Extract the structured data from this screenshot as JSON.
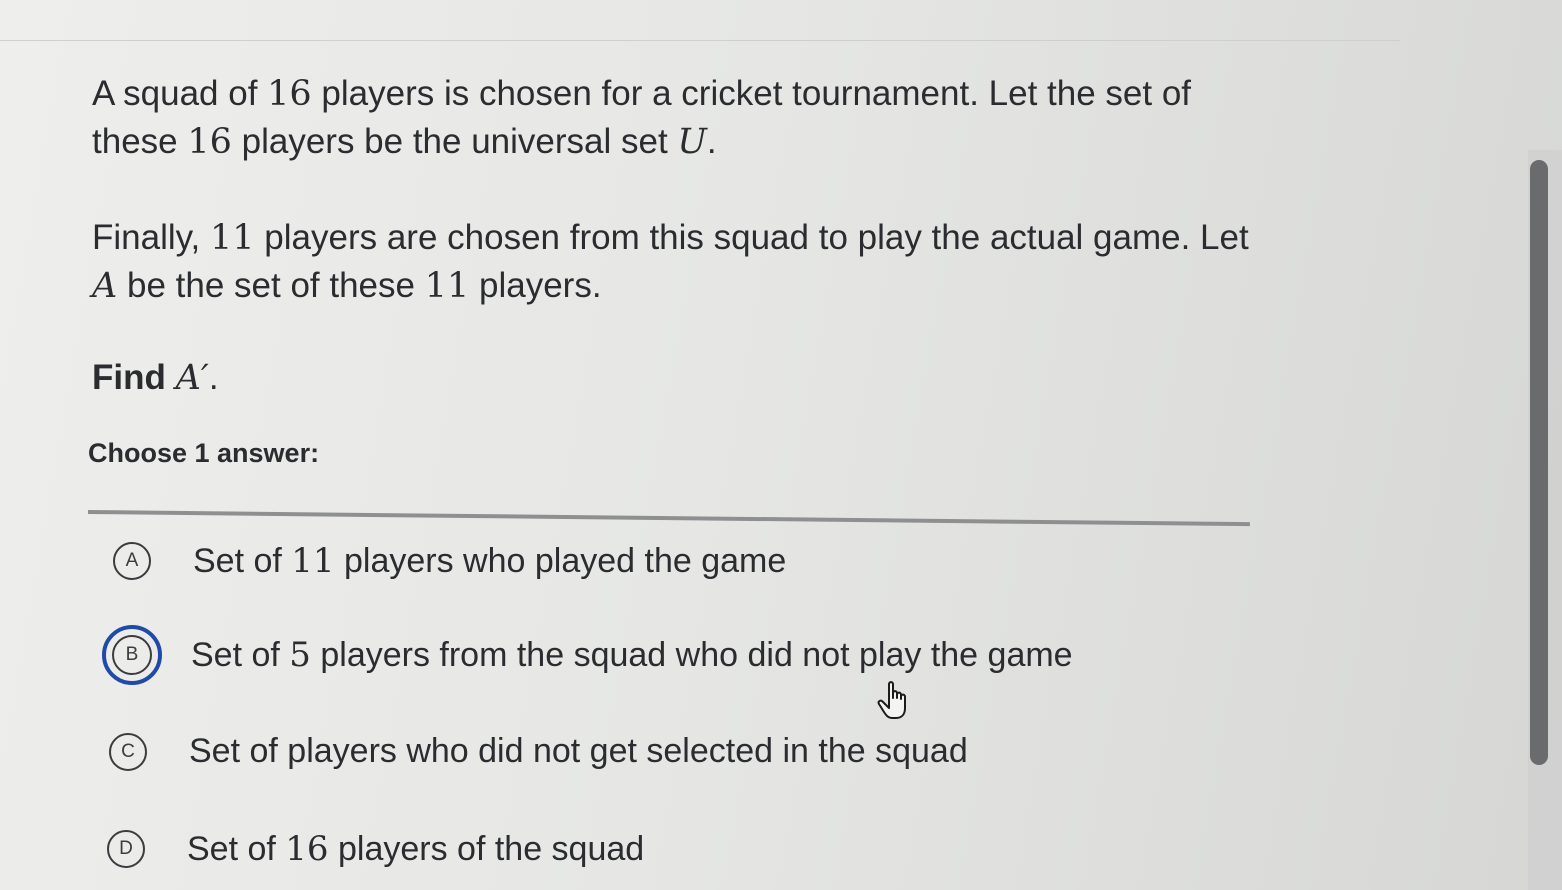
{
  "question": {
    "p1": {
      "t1": "A squad of ",
      "n1": "16",
      "t2": " players is chosen for a cricket tournament. Let the set of these ",
      "n2": "16",
      "t3": " players be the universal set ",
      "m1": "U",
      "t4": "."
    },
    "p2": {
      "t1": "Finally, ",
      "n1": "11",
      "t2": " players are chosen from this squad to play the actual game. Let ",
      "m1": "A",
      "t3": " be the set of these ",
      "n2": "11",
      "t4": " players."
    },
    "find": {
      "label": "Find ",
      "math": "A′",
      "end": "."
    }
  },
  "choose_label": "Choose 1 answer:",
  "choices": [
    {
      "letter": "A",
      "pre": "Set of ",
      "num": "11",
      "post": " players who played the game",
      "selected": false
    },
    {
      "letter": "B",
      "pre": "Set of ",
      "num": "5",
      "post": " players from the squad who did not play the game",
      "selected": true
    },
    {
      "letter": "C",
      "pre": "Set of players who did not get selected in the squad",
      "num": "",
      "post": "",
      "selected": false
    },
    {
      "letter": "D",
      "pre": "Set of ",
      "num": "16",
      "post": " players of the squad",
      "selected": false
    }
  ],
  "colors": {
    "selected_ring": "#1f4aa8",
    "text": "#2b2c30"
  },
  "icons": {
    "cursor": "hand-pointer-icon"
  }
}
